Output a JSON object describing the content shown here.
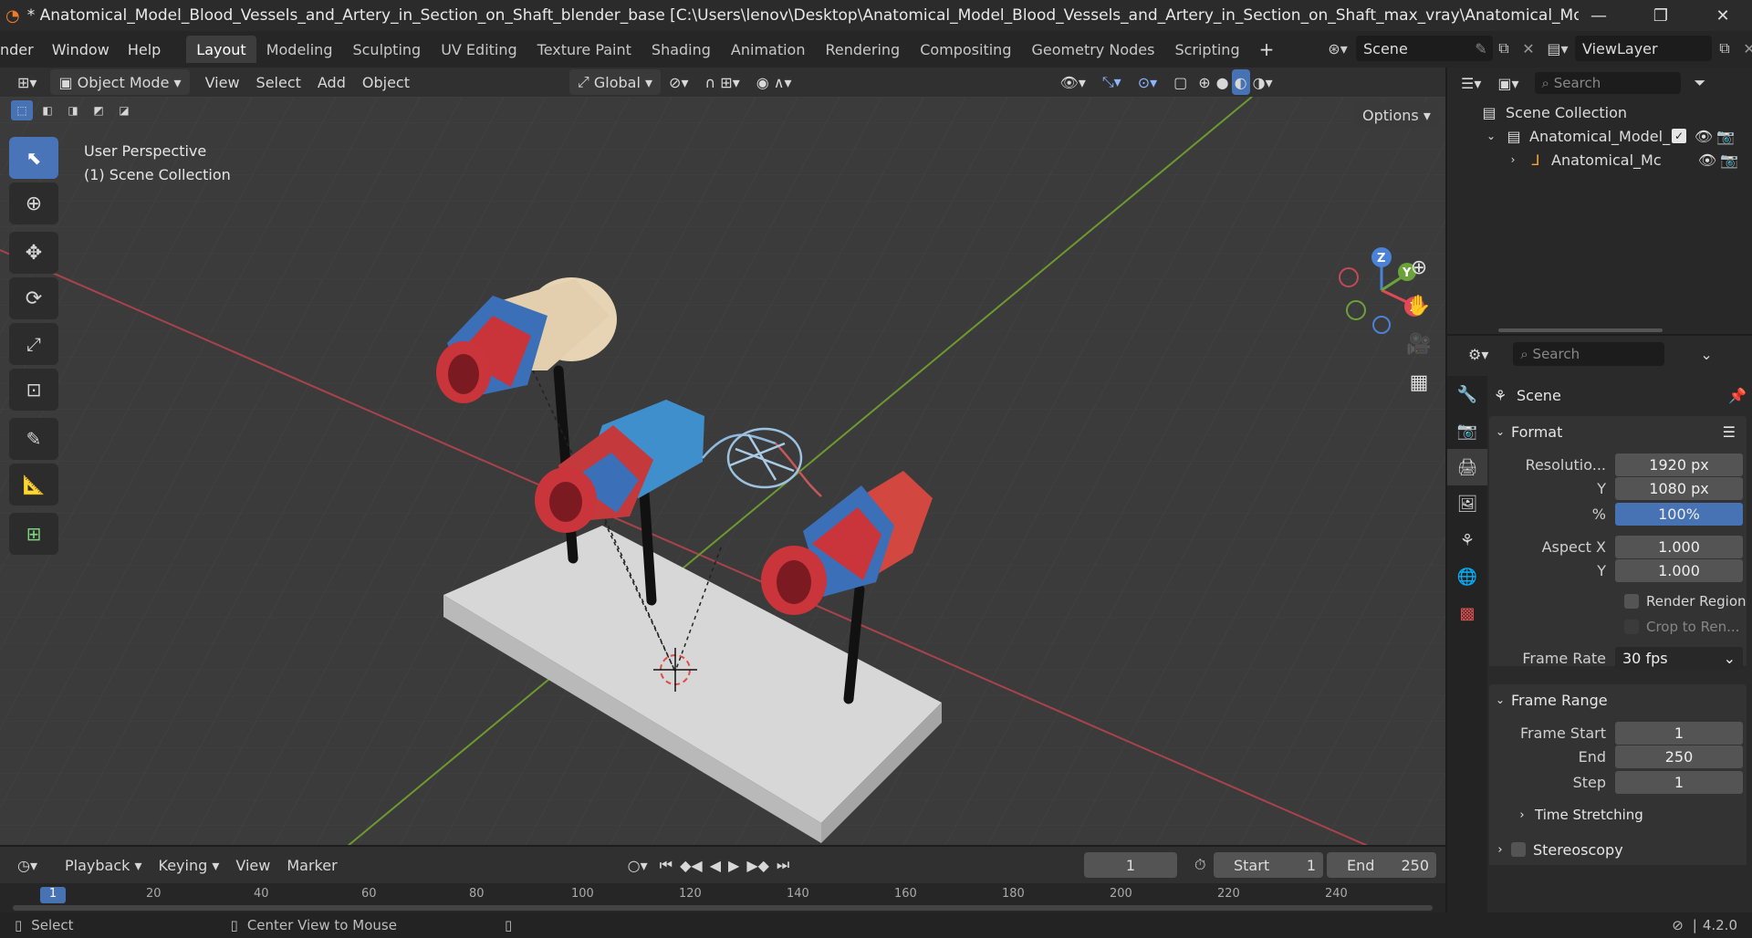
{
  "window": {
    "title": "* Anatomical_Model_Blood_Vessels_and_Artery_in_Section_on_Shaft_blender_base [C:\\Users\\lenov\\Desktop\\Anatomical_Model_Blood_Vessels_and_Artery_in_Section_on_Shaft_max_vray\\Anatomical_Model_Blood_Vessels_and..."
  },
  "menu": {
    "items": [
      "nder",
      "Window",
      "Help"
    ],
    "workspaces": [
      "Layout",
      "Modeling",
      "Sculpting",
      "UV Editing",
      "Texture Paint",
      "Shading",
      "Animation",
      "Rendering",
      "Compositing",
      "Geometry Nodes",
      "Scripting"
    ],
    "scene": "Scene",
    "view_layer": "ViewLayer"
  },
  "viewport_header": {
    "mode": "Object Mode",
    "menus": [
      "View",
      "Select",
      "Add",
      "Object"
    ],
    "transform": "Global",
    "options": "Options"
  },
  "viewport": {
    "perspective": "User Perspective",
    "collection": "(1) Scene Collection",
    "gizmo": {
      "x": "X",
      "y": "Y",
      "z": "Z"
    }
  },
  "timeline": {
    "menus": [
      "Playback",
      "Keying",
      "View",
      "Marker"
    ],
    "current_frame": "1",
    "start_label": "Start",
    "start": "1",
    "end_label": "End",
    "end": "250",
    "ruler": [
      "1",
      "20",
      "40",
      "60",
      "80",
      "100",
      "120",
      "140",
      "160",
      "180",
      "200",
      "220",
      "240"
    ]
  },
  "status": {
    "select": "Select",
    "center": "Center View to Mouse",
    "version": "4.2.0"
  },
  "outliner": {
    "search_placeholder": "Search",
    "root": "Scene Collection",
    "collection": "Anatomical_Model_",
    "object": "Anatomical_Mc"
  },
  "properties": {
    "search_placeholder": "Search",
    "context": "Scene",
    "format": {
      "title": "Format",
      "res_x_label": "Resolutio...",
      "res_x": "1920 px",
      "res_y_label": "Y",
      "res_y": "1080 px",
      "pct_label": "%",
      "pct": "100%",
      "aspect_x_label": "Aspect X",
      "aspect_x": "1.000",
      "aspect_y_label": "Y",
      "aspect_y": "1.000",
      "render_region": "Render Region",
      "crop": "Crop to Ren...",
      "frame_rate_label": "Frame Rate",
      "frame_rate": "30 fps"
    },
    "frame_range": {
      "title": "Frame Range",
      "start_label": "Frame Start",
      "start": "1",
      "end_label": "End",
      "end": "250",
      "step_label": "Step",
      "step": "1"
    },
    "time_stretching": "Time Stretching",
    "stereoscopy": "Stereoscopy"
  }
}
